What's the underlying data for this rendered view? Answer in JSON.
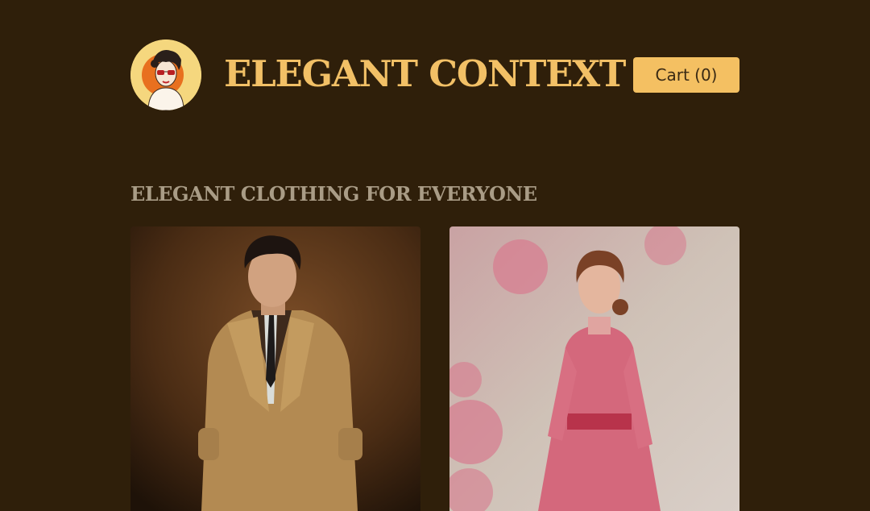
{
  "header": {
    "brand": "ELEGANT CONTEXT",
    "cart_label": "Cart (0)"
  },
  "main": {
    "heading": "ELEGANT CLOTHING FOR EVERYONE",
    "products": [
      {
        "image": "man-in-trench-coat-photo"
      },
      {
        "image": "woman-in-pink-dress-photo"
      }
    ]
  },
  "colors": {
    "background": "#2f1f0a",
    "accent": "#f2c066",
    "cart_button": "#f4c062",
    "heading": "#a99c86"
  }
}
